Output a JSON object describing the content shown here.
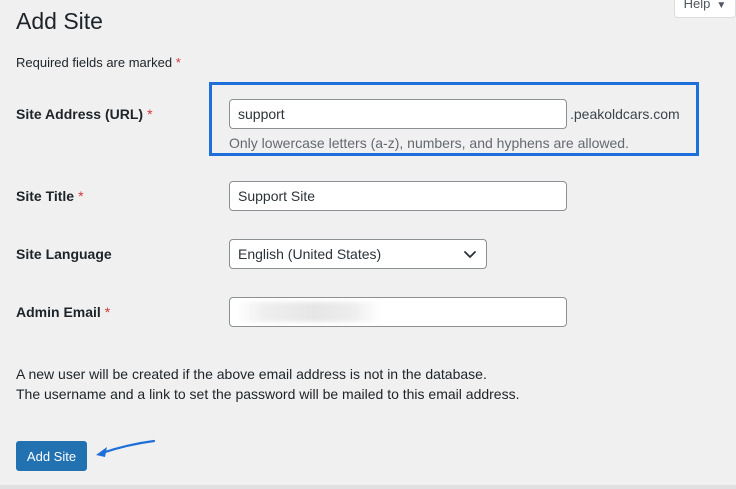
{
  "help_tab": {
    "label": "Help",
    "caret": "▼"
  },
  "page": {
    "title": "Add Site",
    "required_note": "Required fields are marked",
    "required_marker": "*"
  },
  "fields": {
    "site_address": {
      "label": "Site Address (URL)",
      "value": "support",
      "domain_suffix": ".peakoldcars.com",
      "help": "Only lowercase letters (a-z), numbers, and hyphens are allowed."
    },
    "site_title": {
      "label": "Site Title",
      "value": "Support Site"
    },
    "site_language": {
      "label": "Site Language",
      "selected": "English (United States)"
    },
    "admin_email": {
      "label": "Admin Email",
      "value": ""
    }
  },
  "notes": {
    "line1": "A new user will be created if the above email address is not in the database.",
    "line2": "The username and a link to set the password will be mailed to this email address."
  },
  "submit": {
    "label": "Add Site"
  },
  "colors": {
    "background": "#f0f0f1",
    "primary": "#2271b1",
    "highlight": "#1e6fd9",
    "required": "#d63638"
  }
}
